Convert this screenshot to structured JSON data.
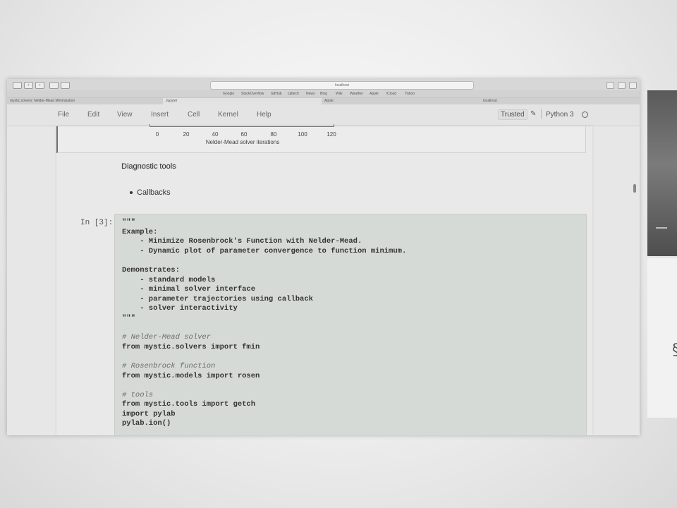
{
  "browser": {
    "url": "localhost",
    "bookmarks": [
      "Google",
      "StackOverflow",
      "GitHub",
      "caltech",
      "News",
      "Bing",
      "Wiki",
      "Weather",
      "Apple",
      "iCloud",
      "Yahoo"
    ],
    "tabs": [
      "mystic.solvers: Nelder-Mead Minimization",
      "Jupyter",
      "Apple",
      "localhost"
    ]
  },
  "menubar": {
    "items": [
      "File",
      "Edit",
      "View",
      "Insert",
      "Cell",
      "Kernel",
      "Help"
    ],
    "trusted_label": "Trusted",
    "kernel_name": "Python 3"
  },
  "plot_output": {
    "x_ticks": [
      "0",
      "20",
      "40",
      "60",
      "80",
      "100",
      "120"
    ],
    "x_axis_label": "Nelder-Mead solver iterations"
  },
  "markdown": {
    "heading": "Diagnostic tools",
    "list_items": [
      "Callbacks"
    ]
  },
  "code_cell": {
    "prompt": "In [3]:",
    "lines": [
      {
        "text": "\"\"\"",
        "kind": "code"
      },
      {
        "text": "Example:",
        "kind": "code"
      },
      {
        "text": "    - Minimize Rosenbrock's Function with Nelder-Mead.",
        "kind": "code"
      },
      {
        "text": "    - Dynamic plot of parameter convergence to function minimum.",
        "kind": "code"
      },
      {
        "text": "",
        "kind": "code"
      },
      {
        "text": "Demonstrates:",
        "kind": "code"
      },
      {
        "text": "    - standard models",
        "kind": "code"
      },
      {
        "text": "    - minimal solver interface",
        "kind": "code"
      },
      {
        "text": "    - parameter trajectories using callback",
        "kind": "code"
      },
      {
        "text": "    - solver interactivity",
        "kind": "code"
      },
      {
        "text": "\"\"\"",
        "kind": "code"
      },
      {
        "text": "",
        "kind": "code"
      },
      {
        "text": "# Nelder-Mead solver",
        "kind": "comment"
      },
      {
        "text": "from mystic.solvers import fmin",
        "kind": "code"
      },
      {
        "text": "",
        "kind": "code"
      },
      {
        "text": "# Rosenbrock function",
        "kind": "comment"
      },
      {
        "text": "from mystic.models import rosen",
        "kind": "code"
      },
      {
        "text": "",
        "kind": "code"
      },
      {
        "text": "# tools",
        "kind": "comment"
      },
      {
        "text": "from mystic.tools import getch",
        "kind": "code"
      },
      {
        "text": "import pylab",
        "kind": "code"
      },
      {
        "text": "pylab.ion()",
        "kind": "code"
      }
    ]
  }
}
